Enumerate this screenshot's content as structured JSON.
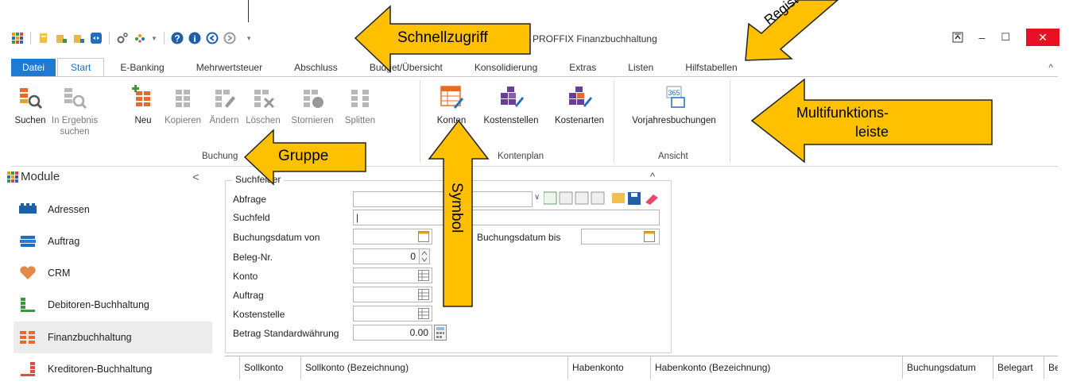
{
  "window": {
    "title": "PROFFIX Finanzbuchhaltung",
    "close_label": "✕",
    "min_label": "–",
    "max_label": "☐"
  },
  "tabs": [
    {
      "label": "Datei"
    },
    {
      "label": "Start"
    },
    {
      "label": "E-Banking"
    },
    {
      "label": "Mehrwertsteuer"
    },
    {
      "label": "Abschluss"
    },
    {
      "label": "Budget/Übersicht"
    },
    {
      "label": "Konsolidierung"
    },
    {
      "label": "Extras"
    },
    {
      "label": "Listen"
    },
    {
      "label": "Hilfstabellen"
    }
  ],
  "ribbon": {
    "buttons": [
      {
        "label": "Suchen",
        "label2": ""
      },
      {
        "label": "In Ergebnis",
        "label2": "suchen"
      },
      {
        "label": "Neu",
        "label2": ""
      },
      {
        "label": "Kopieren",
        "label2": ""
      },
      {
        "label": "Ändern",
        "label2": ""
      },
      {
        "label": "Löschen",
        "label2": ""
      },
      {
        "label": "Stornieren",
        "label2": ""
      },
      {
        "label": "Splitten",
        "label2": ""
      },
      {
        "label": "Konten",
        "label2": ""
      },
      {
        "label": "Kostenstellen",
        "label2": ""
      },
      {
        "label": "Kostenarten",
        "label2": ""
      },
      {
        "label": "Vorjahresbuchungen",
        "label2": ""
      }
    ],
    "groups": {
      "buchung": "Buchung",
      "kontenplan": "Kontenplan",
      "ansicht": "Ansicht"
    }
  },
  "sidebar": {
    "title": "Module",
    "collapse": "<",
    "items": [
      {
        "label": "Adressen"
      },
      {
        "label": "Auftrag"
      },
      {
        "label": "CRM"
      },
      {
        "label": "Debitoren-Buchhaltung"
      },
      {
        "label": "Finanzbuchhaltung"
      },
      {
        "label": "Kreditoren-Buchhaltung"
      }
    ]
  },
  "search_panel": {
    "legend": "Suchfelder",
    "fields": {
      "abfrage": "Abfrage",
      "suchfeld": "Suchfeld",
      "datum_von": "Buchungsdatum von",
      "datum_bis": "Buchungsdatum bis",
      "beleg": "Beleg-Nr.",
      "konto": "Konto",
      "auftrag": "Auftrag",
      "kostenstelle": "Kostenstelle",
      "betrag": "Betrag Standardwährung"
    },
    "values": {
      "beleg": "0",
      "betrag": "0.00",
      "suchfeld": "|"
    }
  },
  "table": {
    "columns": [
      "Sollkonto",
      "Sollkonto (Bezeichnung)",
      "Habenkonto",
      "Habenkonto (Bezeichnung)",
      "Buchungsdatum",
      "Belegart",
      "Be"
    ]
  },
  "callouts": {
    "schnellzugriff": "Schnellzugriff",
    "register": "Register",
    "multifunktion_1": "Multifunktions-",
    "multifunktion_2": "leiste",
    "gruppe": "Gruppe",
    "symbol": "Symbol"
  },
  "colors": {
    "callout_fill": "#FFC000",
    "file_tab": "#1E7BD4",
    "close_button": "#E81123"
  }
}
